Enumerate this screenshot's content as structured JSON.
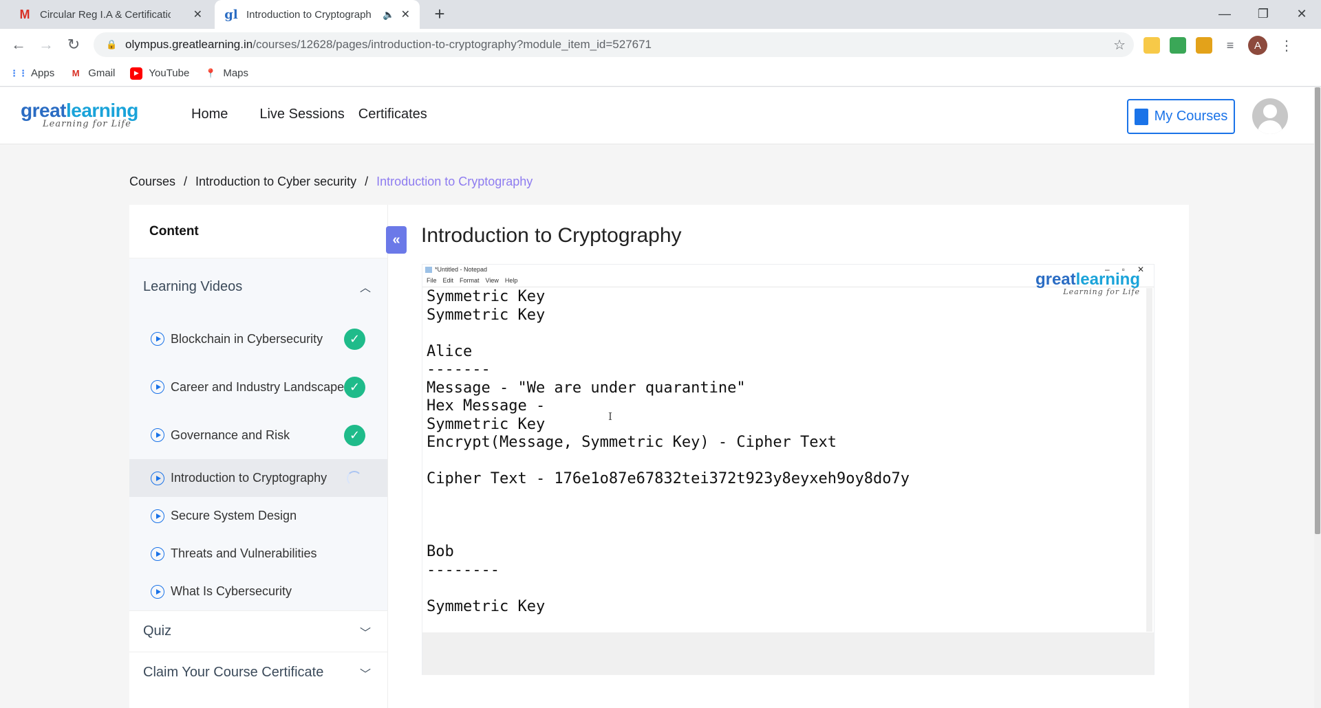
{
  "browser": {
    "tabs": [
      {
        "title": "Circular Reg I.A & Certifications/",
        "favicon": "M",
        "active": false
      },
      {
        "title": "Introduction to Cryptograph",
        "favicon": "gl",
        "active": true
      }
    ],
    "url_domain": "olympus.greatlearning.in",
    "url_path": "/courses/12628/pages/introduction-to-cryptography?module_item_id=527671",
    "profile_initial": "A",
    "bookmarks": [
      {
        "label": "Apps",
        "icon": "apps-grid-icon"
      },
      {
        "label": "Gmail",
        "icon": "gmail-icon"
      },
      {
        "label": "YouTube",
        "icon": "youtube-icon"
      },
      {
        "label": "Maps",
        "icon": "maps-icon"
      }
    ]
  },
  "header": {
    "logo_great": "great",
    "logo_learning": "learning",
    "logo_tagline": "Learning for Life",
    "nav": [
      "Home",
      "Live Sessions",
      "Certificates"
    ],
    "my_courses": "My Courses"
  },
  "breadcrumb": {
    "items": [
      "Courses",
      "Introduction to Cyber security"
    ],
    "current": "Introduction to Cryptography",
    "separator": "/"
  },
  "sidebar": {
    "heading": "Content",
    "learning_videos": {
      "label": "Learning Videos",
      "expanded": true,
      "items": [
        {
          "label": "Blockchain in Cybersecurity",
          "status": "completed"
        },
        {
          "label": "Career and Industry Landscape",
          "status": "completed"
        },
        {
          "label": "Governance and Risk",
          "status": "completed"
        },
        {
          "label": "Introduction to Cryptography",
          "status": "in-progress"
        },
        {
          "label": "Secure System Design",
          "status": "none"
        },
        {
          "label": "Threats and Vulnerabilities",
          "status": "none"
        },
        {
          "label": "What Is Cybersecurity",
          "status": "none"
        }
      ]
    },
    "quiz": {
      "label": "Quiz"
    },
    "certificate": {
      "label": "Claim Your Course Certificate"
    }
  },
  "main": {
    "title": "Introduction to Cryptography",
    "video": {
      "notepad_title": "*Untitled - Notepad",
      "notepad_menu": [
        "File",
        "Edit",
        "Format",
        "View",
        "Help"
      ],
      "watermark_great": "great",
      "watermark_learning": "learning",
      "watermark_tagline": "Learning for Life",
      "text_lines": [
        "Symmetric Key",
        "Symmetric Key",
        "",
        "Alice",
        "-------",
        "Message - \"We are under quarantine\"",
        "Hex Message -",
        "Symmetric Key",
        "Encrypt(Message, Symmetric Key) - Cipher Text",
        "",
        "Cipher Text - 176e1o87e67832tei372t923y8eyxeh9oy8do7y",
        "",
        "",
        "",
        "Bob",
        "--------",
        "",
        "Symmetric Key"
      ]
    }
  },
  "colors": {
    "accent": "#1a73e8",
    "breadcrumb_current": "#8e7cf0",
    "completed": "#1fbb8a",
    "collapse_button": "#6b79e8"
  }
}
